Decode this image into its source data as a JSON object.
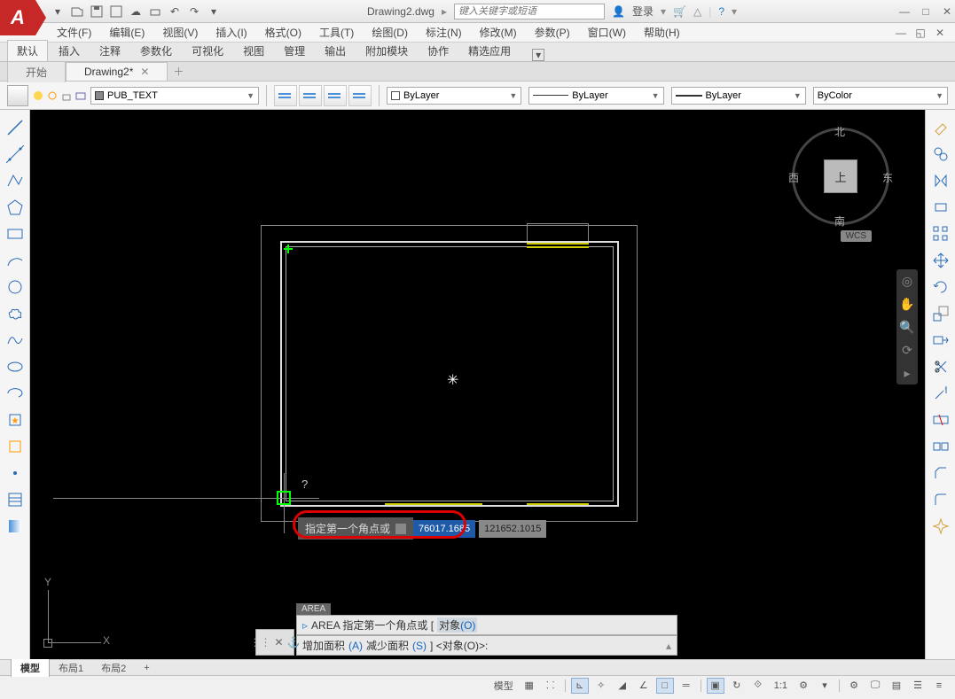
{
  "app": {
    "logo": "A"
  },
  "titlebar": {
    "doc": "Drawing2.dwg",
    "search_placeholder": "键入关键字或短语",
    "login": "登录"
  },
  "menubar": {
    "items": [
      "文件(F)",
      "编辑(E)",
      "视图(V)",
      "插入(I)",
      "格式(O)",
      "工具(T)",
      "绘图(D)",
      "标注(N)",
      "修改(M)",
      "参数(P)",
      "窗口(W)",
      "帮助(H)"
    ]
  },
  "ribbon_tabs": {
    "items": [
      "默认",
      "插入",
      "注释",
      "参数化",
      "可视化",
      "视图",
      "管理",
      "输出",
      "附加模块",
      "协作",
      "精选应用"
    ],
    "active": 0
  },
  "file_tabs": {
    "items": [
      {
        "label": "开始",
        "active": false,
        "closable": false
      },
      {
        "label": "Drawing2*",
        "active": true,
        "closable": true
      }
    ]
  },
  "ribbon_panel": {
    "layer": "PUB_TEXT",
    "props": [
      {
        "label": "ByLayer"
      },
      {
        "label": "ByLayer"
      },
      {
        "label": "ByLayer"
      },
      {
        "label": "ByColor"
      }
    ]
  },
  "viewcube": {
    "north": "北",
    "south": "南",
    "east": "东",
    "west": "西",
    "top": "上",
    "wcs": "WCS"
  },
  "dynamic_input": {
    "prompt": "指定第一个角点或",
    "coord1": "76017.1685",
    "coord2": "121652.1015"
  },
  "command": {
    "tag": "AREA",
    "line1_pre": "AREA 指定第一个角点或 [",
    "line1_opt1": "对象",
    "line1_opt1k": "(O)",
    "line1_mid": "",
    "line2_pre": "增加面积",
    "line2_k1": "(A)",
    "line2_mid": " 减少面积",
    "line2_k2": "(S)",
    "line2_post": "] <对象(O)>: "
  },
  "layout_tabs": {
    "items": [
      "模型",
      "布局1",
      "布局2"
    ],
    "active": 0
  },
  "statusbar": {
    "model": "模型",
    "scale": "1:1"
  },
  "ucs": {
    "x": "X",
    "y": "Y"
  }
}
